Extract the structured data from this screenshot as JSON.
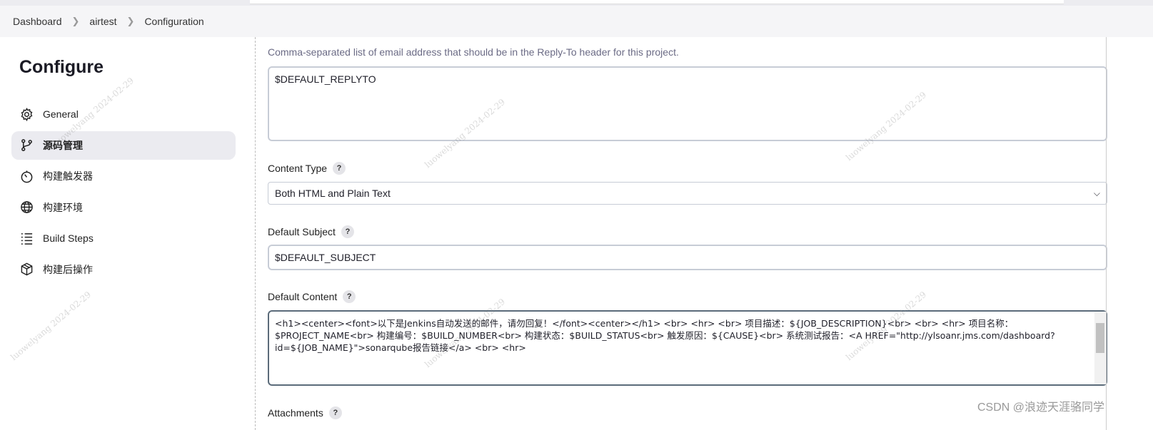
{
  "breadcrumb": [
    "Dashboard",
    "airtest",
    "Configuration"
  ],
  "sidebar": {
    "title": "Configure",
    "items": [
      {
        "label": "General",
        "icon": "gear-icon",
        "active": false
      },
      {
        "label": "源码管理",
        "icon": "branch-icon",
        "active": true
      },
      {
        "label": "构建触发器",
        "icon": "timer-icon",
        "active": false
      },
      {
        "label": "构建环境",
        "icon": "globe-icon",
        "active": false
      },
      {
        "label": "Build Steps",
        "icon": "list-icon",
        "active": false
      },
      {
        "label": "构建后操作",
        "icon": "package-icon",
        "active": false
      }
    ]
  },
  "form": {
    "reply_to_help": "Comma-separated list of email address that should be in the Reply-To header for this project.",
    "reply_to_value": "$DEFAULT_REPLYTO",
    "content_type_label": "Content Type",
    "content_type_value": "Both HTML and Plain Text",
    "subject_label": "Default Subject",
    "subject_value": "$DEFAULT_SUBJECT",
    "content_label": "Default Content",
    "content_value": "<h1><center><font>以下是Jenkins自动发送的邮件，请勿回复！</font><center></h1> <br> <hr> <br> 项目描述：${JOB_DESCRIPTION}<br> <br> <hr> 项目名称：$PROJECT_NAME<br> 构建编号：$BUILD_NUMBER<br> 构建状态：$BUILD_STATUS<br> 触发原因：${CAUSE}<br> 系统测试报告：<A HREF=\"http://ylsoanr.jms.com/dashboard?id=${JOB_NAME}\">sonarqube报告链接</a> <br> <hr>",
    "attachments_label": "Attachments",
    "help_mark": "?"
  },
  "watermark": "luowelyang 2024-02-29",
  "csdn_credit": "CSDN @浪迹天涯骆同学"
}
